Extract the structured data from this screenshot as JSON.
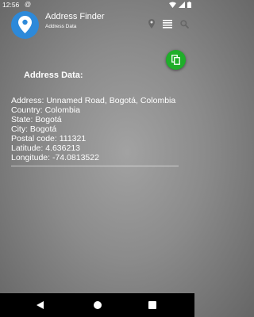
{
  "status_bar": {
    "time": "12:56",
    "at_symbol": "@"
  },
  "app_bar": {
    "title": "Address Finder",
    "subtitle": "Address Data",
    "icons": [
      "location-pin-icon",
      "list-icon",
      "search-icon"
    ]
  },
  "fab": {
    "icon": "copy-icon",
    "color": "#1fae2a"
  },
  "content": {
    "heading": "Address Data:",
    "lines": [
      "Address: Unnamed Road, Bogotá, Colombia",
      "Country: Colombia",
      "State: Bogotá",
      "City: Bogotá",
      "Postal code: 111321",
      "Latitude: 4.636213",
      "Longitude: -74.0813522"
    ]
  },
  "colors": {
    "logo": "#2d89d9",
    "background": "#8b8b8b",
    "nav_bar": "#000000"
  }
}
